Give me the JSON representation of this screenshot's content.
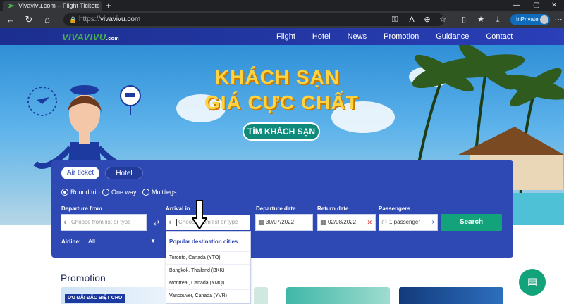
{
  "browser": {
    "tab_title": "Vivavivu.com – Flight Tickets - Ch",
    "tab_close": "×",
    "new_tab": "+",
    "url_proto": "https://",
    "url_host": "vivavivu.com",
    "inprivate_label": "InPrivate"
  },
  "site": {
    "logo_text": "VIVAVIVU",
    "logo_suffix": ".com",
    "nav": [
      "Flight",
      "Hotel",
      "News",
      "Promotion",
      "Guidance",
      "Contact"
    ]
  },
  "hero": {
    "line1": "KHÁCH SẠN",
    "line2": "GIÁ CỰC CHẤT",
    "cta": "TÌM KHÁCH SẠN"
  },
  "search": {
    "tabs": [
      {
        "label": "Air ticket",
        "active": true
      },
      {
        "label": "Hotel",
        "active": false
      }
    ],
    "trip_types": [
      {
        "label": "Round trip",
        "selected": true
      },
      {
        "label": "One way",
        "selected": false
      },
      {
        "label": "Multilegs",
        "selected": false
      }
    ],
    "departure": {
      "label": "Departure from",
      "placeholder": "Choose from list or type"
    },
    "arrival": {
      "label": "Arrival in",
      "placeholder": "Choose from list or type"
    },
    "departure_date": {
      "label": "Departure date",
      "value": "30/07/2022"
    },
    "return_date": {
      "label": "Return date",
      "value": "02/08/2022"
    },
    "passengers": {
      "label": "Passengers",
      "value": "1 passenger"
    },
    "search_button": "Search",
    "airline": {
      "label": "Airline:",
      "value": "All"
    }
  },
  "dropdown": {
    "heading": "Popular destination cities",
    "items": [
      "Toronto, Canada (YTO)",
      "Bangkok, Thailand (BKK)",
      "Montreal, Canada (YMQ)",
      "Vancouver, Canada (YVR)"
    ]
  },
  "promotion": {
    "title": "Promotion",
    "badge": "ƯU ĐÃI ĐẶC BIỆT CHO"
  },
  "colors": {
    "brand_blue": "#2e49b4",
    "brand_green": "#12a37a",
    "hero_yellow": "#ffd23f"
  }
}
